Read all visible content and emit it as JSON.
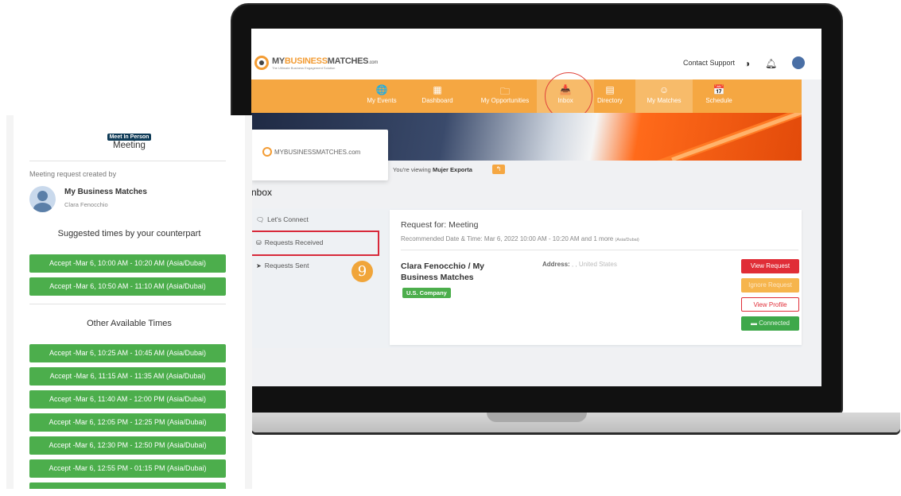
{
  "screen": {
    "topbar": {
      "logo_main_prefix": "MY",
      "logo_main_accent": "BUSINESS",
      "logo_main_suffix": "MATCHES",
      "logo_tld": ".com",
      "logo_tagline": "The Ultimate Business Engagement Solution",
      "contact_support": "Contact Support"
    },
    "nav": [
      {
        "label": "My Events",
        "icon": "globe-icon",
        "glyph": "🌐"
      },
      {
        "label": "Dashboard",
        "icon": "dashboard-icon",
        "glyph": "▦"
      },
      {
        "label": "My Opportunities",
        "icon": "folder-icon",
        "glyph": "🗀"
      },
      {
        "label": "Inbox",
        "icon": "inbox-icon",
        "glyph": "📥"
      },
      {
        "label": "Directory",
        "icon": "directory-icon",
        "glyph": "▤"
      },
      {
        "label": "My Matches",
        "icon": "user-icon",
        "glyph": "☺"
      },
      {
        "label": "Schedule",
        "icon": "calendar-icon",
        "glyph": "📅"
      }
    ],
    "logo_card_text": "MYBUSINESSMATCHES.com",
    "viewing_prefix": "You're viewing",
    "viewing_event": "Mujer Exporta",
    "inbox_title": "nbox",
    "sidebar": [
      {
        "label": "Let's Connect",
        "icon": "chat-icon",
        "glyph": "🗨"
      },
      {
        "label": "Requests Received",
        "icon": "inbox-tray-icon",
        "glyph": "⛁"
      },
      {
        "label": "Requests Sent",
        "icon": "send-icon",
        "glyph": "➤"
      }
    ],
    "step_number": "9",
    "request": {
      "title": "Request for: Meeting",
      "date_text": "Recommended Date & Time: Mar 6, 2022 10:00 AM - 10:20 AM  and 1 more",
      "timezone": "(Asia/Dubai)",
      "name": "Clara Fenocchio / My Business Matches",
      "badge": "U.S. Company",
      "address_label": "Address:",
      "address_value": ", , United States",
      "btn_view": "View Request",
      "btn_ignore": "Ignore Request",
      "btn_profile": "View Profile",
      "btn_connected": "Connected"
    }
  },
  "panel": {
    "tag": "Meet In Person",
    "title": "Meeting",
    "created_by_label": "Meeting request created by",
    "organizer": "My Business Matches",
    "person": "Clara Fenocchio",
    "suggested_title": "Suggested times by your counterpart",
    "suggested": [
      "Accept -Mar 6, 10:00 AM - 10:20 AM (Asia/Dubai)",
      "Accept -Mar 6, 10:50 AM - 11:10 AM (Asia/Dubai)"
    ],
    "other_title": "Other Available Times",
    "other": [
      "Accept -Mar 6, 10:25 AM - 10:45 AM (Asia/Dubai)",
      "Accept -Mar 6, 11:15 AM - 11:35 AM (Asia/Dubai)",
      "Accept -Mar 6, 11:40 AM - 12:00 PM (Asia/Dubai)",
      "Accept -Mar 6, 12:05 PM - 12:25 PM (Asia/Dubai)",
      "Accept -Mar 6, 12:30 PM - 12:50 PM (Asia/Dubai)",
      "Accept -Mar 6, 12:55 PM - 01:15 PM (Asia/Dubai)"
    ]
  },
  "colors": {
    "brand_orange": "#f5a742",
    "accept_green": "#4cae4c",
    "view_red": "#e02d37",
    "tag_navy": "#0e3b57"
  }
}
